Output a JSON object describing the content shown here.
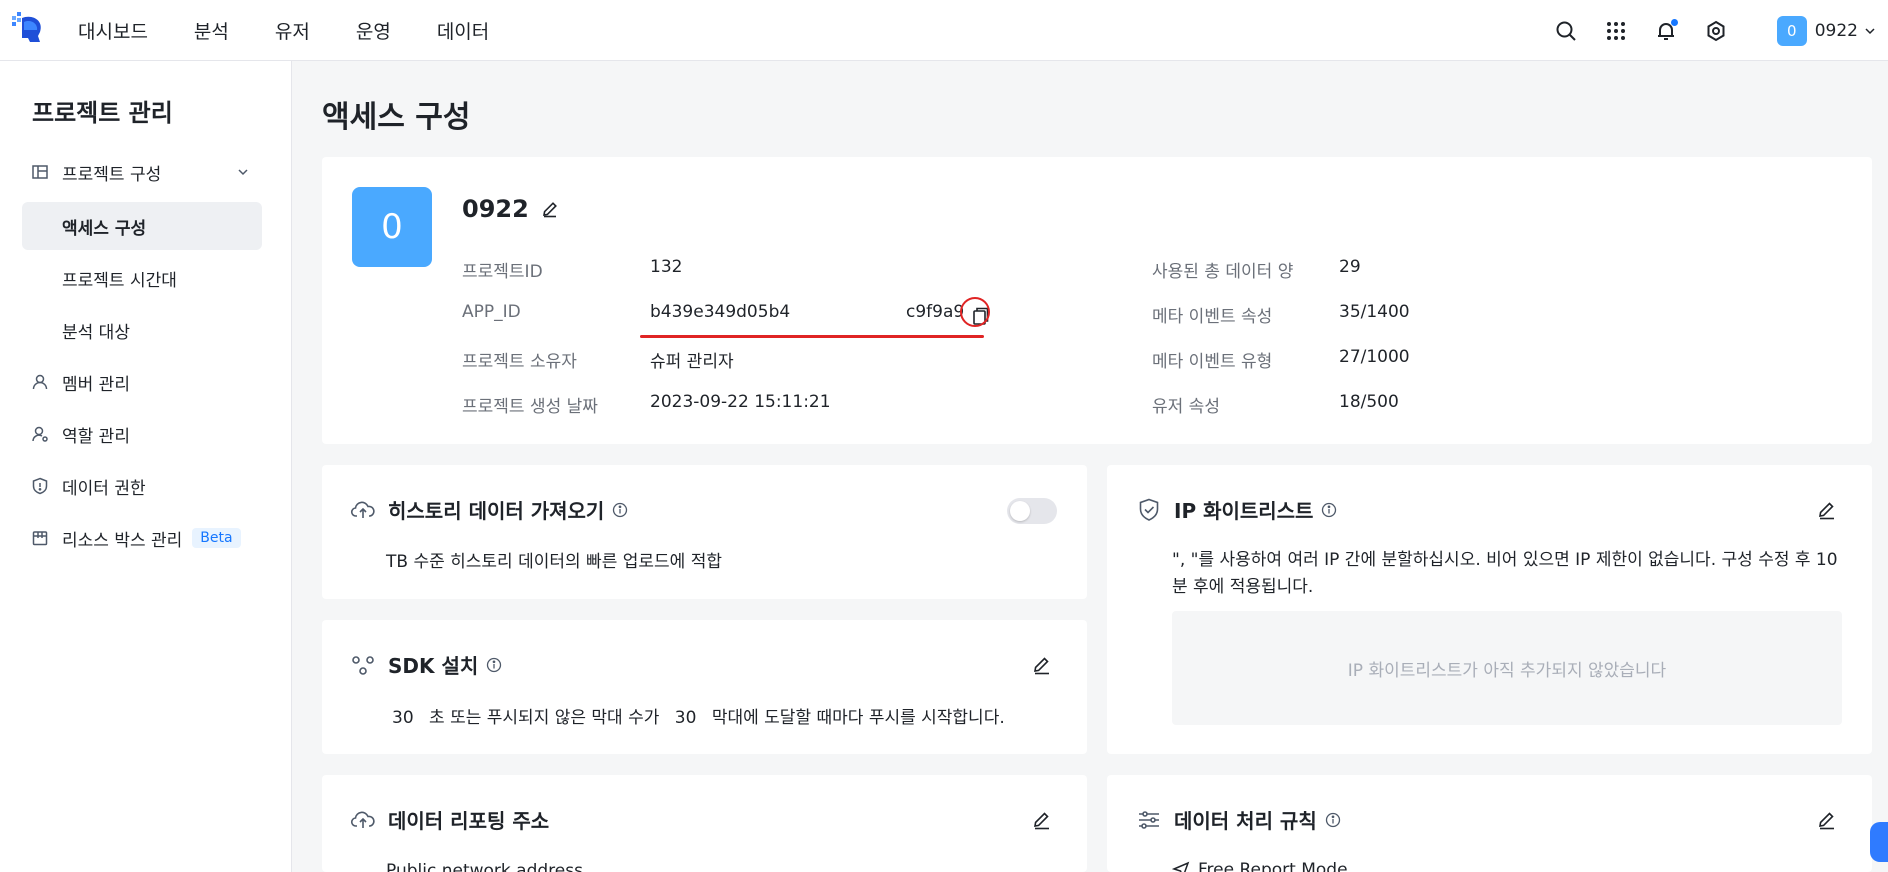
{
  "nav": {
    "items": [
      "대시보드",
      "분석",
      "유저",
      "운영",
      "데이터"
    ]
  },
  "user": {
    "avatar": "0",
    "name": "0922"
  },
  "sidebar": {
    "title": "프로젝트 관리",
    "group": "프로젝트 구성",
    "sub_items": [
      "액세스 구성",
      "프로젝트 시간대",
      "분석 대상"
    ],
    "items": [
      "멤버 관리",
      "역할 관리",
      "데이터 권한",
      "리소스 박스 관리"
    ],
    "beta": "Beta"
  },
  "page": {
    "title": "액세스 구성"
  },
  "project": {
    "avatar": "0",
    "name": "0922",
    "labels": {
      "id": "프로젝트ID",
      "app_id": "APP_ID",
      "owner": "프로젝트 소유자",
      "created": "프로젝트 생성 날짜",
      "data_used": "사용된 총 데이터 양",
      "meta_event_attr": "메타 이벤트 속성",
      "meta_event_type": "메타 이벤트 유형",
      "user_attr": "유저 속성"
    },
    "values": {
      "id": "132",
      "app_id_start": "b439e349d05b4",
      "app_id_end": "c9f9a9",
      "owner": "슈퍼 관리자",
      "created": "2023-09-22 15:11:21",
      "data_used": "29",
      "meta_event_attr": "35/1400",
      "meta_event_type": "27/1000",
      "user_attr": "18/500"
    }
  },
  "history": {
    "title": "히스토리 데이터 가져오기",
    "desc": "TB 수준 히스토리 데이터의 빠른 업로드에 적합",
    "enabled": false
  },
  "sdk": {
    "title": "SDK 설치",
    "seconds": "30",
    "text1": "초 또는 푸시되지 않은 막대 수가",
    "bars": "30",
    "text2": "막대에 도달할 때마다 푸시를 시작합니다."
  },
  "ip": {
    "title": "IP 화이트리스트",
    "desc_line1": "\", \"를 사용하여 여러 IP 간에 분할하십시오. 비어 있으면 IP 제한이 없습니다. 구성 수정 후 10",
    "desc_line2": "분 후에 적용됩니다.",
    "empty": "IP 화이트리스트가 아직 추가되지 않았습니다"
  },
  "report": {
    "title": "데이터 리포팅 주소",
    "sub": "Public network address"
  },
  "rules": {
    "title": "데이터 처리 규칙",
    "sub": "Free Report Mode"
  }
}
